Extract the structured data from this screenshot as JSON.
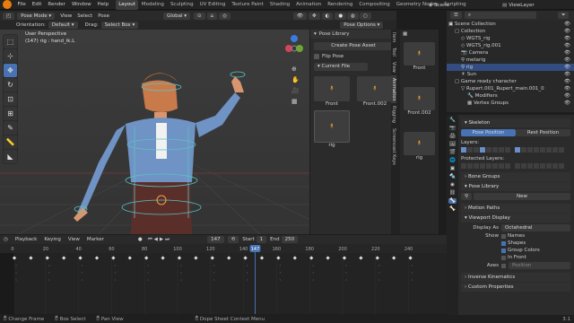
{
  "topbar": {
    "menus": [
      "File",
      "Edit",
      "Render",
      "Window",
      "Help"
    ],
    "workspaces": [
      "Layout",
      "Modeling",
      "Sculpting",
      "UV Editing",
      "Texture Paint",
      "Shading",
      "Animation",
      "Rendering",
      "Compositing",
      "Geometry Nodes",
      "Scripting"
    ],
    "active_workspace": "Layout",
    "scene": "Scene",
    "view_layer": "ViewLayer"
  },
  "viewport": {
    "mode": "Pose Mode",
    "menus": [
      "View",
      "Select",
      "Pose"
    ],
    "orientation_label": "Orientation:",
    "orientation_value": "Default",
    "drag_label": "Drag:",
    "drag_value": "Select Box",
    "transform_orientation": "Global",
    "pose_options": "Pose Options",
    "overlay_title": "User Perspective",
    "overlay_subtitle": "(147) rig : hand_ik.L"
  },
  "npanel": {
    "title": "Pose Library",
    "create_button": "Create Pose Asset",
    "flip_pose": "Flip Pose",
    "library_select": "Current File",
    "assets": [
      "Front",
      "Front.002",
      "rig"
    ],
    "tabs": [
      "Item",
      "Tool",
      "View",
      "Animation",
      "Rigging",
      "Screencast Keys"
    ]
  },
  "asset_strip": {
    "items": [
      "Front",
      "Front.002",
      "rig"
    ]
  },
  "outliner": {
    "title": "Scene Collection",
    "rows": [
      {
        "label": "Scene Collection",
        "indent": 0
      },
      {
        "label": "Collection",
        "indent": 1
      },
      {
        "label": "WGTS_rig",
        "indent": 2
      },
      {
        "label": "WGTS_rig.001",
        "indent": 2
      },
      {
        "label": "Camera",
        "indent": 2
      },
      {
        "label": "metarig",
        "indent": 2
      },
      {
        "label": "rig",
        "indent": 2
      },
      {
        "label": "Sun",
        "indent": 2
      },
      {
        "label": "Game ready character",
        "indent": 1
      },
      {
        "label": "Rupert.001_Rupert_main.001_0",
        "indent": 2
      },
      {
        "label": "Modifiers",
        "indent": 3
      },
      {
        "label": "Vertex Groups",
        "indent": 3
      }
    ]
  },
  "properties": {
    "skeleton": "Skeleton",
    "pose_position": "Pose Position",
    "rest_position": "Rest Position",
    "layers": "Layers:",
    "protected_layers": "Protected Layers:",
    "bone_groups": "Bone Groups",
    "pose_library": "Pose Library",
    "new_button": "New",
    "motion_paths": "Motion Paths",
    "viewport_display": "Viewport Display",
    "display_as_label": "Display As",
    "display_as_value": "Octahedral",
    "show_label": "Show",
    "show_names": "Names",
    "show_shapes": "Shapes",
    "show_group_colors": "Group Colors",
    "in_front": "In Front",
    "axes_label": "Axes",
    "axes_value": "Position",
    "inverse_kinematics": "Inverse Kinematics",
    "custom_properties": "Custom Properties"
  },
  "timeline": {
    "menus": [
      "Playback",
      "Keying",
      "View",
      "Marker"
    ],
    "current_frame": "147",
    "start_label": "Start",
    "start": "1",
    "end_label": "End",
    "end": "250",
    "ticks": [
      "0",
      "20",
      "40",
      "60",
      "80",
      "100",
      "120",
      "140",
      "160",
      "180",
      "200",
      "220",
      "240"
    ]
  },
  "statusbar": {
    "items": [
      "Change Frame",
      "Box Select",
      "Pan View",
      "Dope Sheet Context Menu"
    ],
    "version": "3.1"
  }
}
